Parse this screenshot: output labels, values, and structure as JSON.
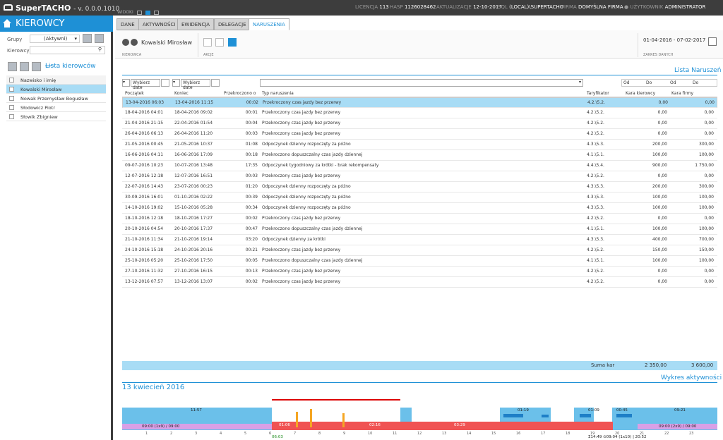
{
  "app": {
    "title": "SuperTACHO",
    "version": "- v. 0.0.0.1010",
    "widoki": "WIDOKI"
  },
  "topinfo": [
    {
      "k": "LICENCJA",
      "v": "113"
    },
    {
      "k": "HASP",
      "v": "1126028462"
    },
    {
      "k": "AKTUALIZACJE",
      "v": "12-10-2017"
    },
    {
      "k": "SQL",
      "v": "(LOCAL)\\SUPERTACHO"
    },
    {
      "k": "FIRMA",
      "v": "DOMYŚLNA FIRMA"
    },
    {
      "k": "UŻYTKOWNIK",
      "v": "ADMINISTRATOR"
    }
  ],
  "left": {
    "title": "KIEROWCY",
    "grupy_label": "Grupy",
    "grupy_value": "(Aktywni)",
    "kierowcy_label": "Kierowcy",
    "lista_title": "Lista kierowców",
    "col_header": "Nazwisko i imię",
    "drivers": [
      "Kowalski Mirosław",
      "Nowak Przemysław Bogusław",
      "Słodowicz Piotr",
      "Słowik Zbigniew"
    ]
  },
  "tabs": [
    "DANE",
    "AKTYWNOŚCI",
    "EWIDENCJA",
    "DELEGACJE",
    "NARUSZENIA"
  ],
  "ribbon": {
    "driver_name": "Kowalski Mirosław",
    "kierowca_label": "KIEROWCA",
    "akcje_label": "AKCJE",
    "date_range": "01-04-2016 - 07-02-2017",
    "zakres_label": "ZAKRES DANYCH"
  },
  "violations": {
    "title": "Lista Naruszeń",
    "filter_date1": "Wybierz datę",
    "filter_date2": "Wybierz datę",
    "od1": "Od",
    "do1": "Do",
    "od2": "Od",
    "do2": "Do",
    "columns": [
      "Początek",
      "Koniec",
      "Przekroczono o",
      "Typ naruszenia",
      "Taryfikator",
      "Kara kierowcy",
      "Kara firmy"
    ],
    "rows": [
      [
        "13-04-2016 06:03",
        "13-04-2016 11:15",
        "00:02",
        "Przekroczony czas jazdy bez przerwy",
        "4.2.\\5.2.",
        "0,00",
        "0,00"
      ],
      [
        "18-04-2016 04:01",
        "18-04-2016 09:02",
        "00:01",
        "Przekroczony czas jazdy bez przerwy",
        "4.2.\\5.2.",
        "0,00",
        "0,00"
      ],
      [
        "21-04-2016 21:15",
        "22-04-2016 01:54",
        "00:04",
        "Przekroczony czas jazdy bez przerwy",
        "4.2.\\5.2.",
        "0,00",
        "0,00"
      ],
      [
        "26-04-2016 06:13",
        "26-04-2016 11:20",
        "00:03",
        "Przekroczony czas jazdy bez przerwy",
        "4.2.\\5.2.",
        "0,00",
        "0,00"
      ],
      [
        "21-05-2016 00:45",
        "21-05-2016 10:37",
        "01:08",
        "Odpoczynek dzienny rozpoczęty za późno",
        "4.3.\\5.3.",
        "200,00",
        "300,00"
      ],
      [
        "16-06-2016 04:11",
        "16-06-2016 17:09",
        "00:18",
        "Przekroczono dopuszczalny czas jazdy dziennej",
        "4.1.\\5.1.",
        "100,00",
        "100,00"
      ],
      [
        "09-07-2016 10:23",
        "10-07-2016 13:48",
        "17:35",
        "Odpoczynek tygodniowy za krótki - brak rekompensaty",
        "4.4.\\5.4.",
        "900,00",
        "1 750,00"
      ],
      [
        "12-07-2016 12:18",
        "12-07-2016 16:51",
        "00:03",
        "Przekroczony czas jazdy bez przerwy",
        "4.2.\\5.2.",
        "0,00",
        "0,00"
      ],
      [
        "22-07-2016 14:43",
        "23-07-2016 00:23",
        "01:20",
        "Odpoczynek dzienny rozpoczęty za późno",
        "4.3.\\5.3.",
        "200,00",
        "300,00"
      ],
      [
        "30-09-2016 16:01",
        "01-10-2016 02:22",
        "00:39",
        "Odpoczynek dzienny rozpoczęty za późno",
        "4.3.\\5.3.",
        "100,00",
        "100,00"
      ],
      [
        "14-10-2016 19:02",
        "15-10-2016 05:28",
        "00:34",
        "Odpoczynek dzienny rozpoczęty za późno",
        "4.3.\\5.3.",
        "100,00",
        "100,00"
      ],
      [
        "18-10-2016 12:18",
        "18-10-2016 17:27",
        "00:02",
        "Przekroczony czas jazdy bez przerwy",
        "4.2.\\5.2.",
        "0,00",
        "0,00"
      ],
      [
        "20-10-2016 04:54",
        "20-10-2016 17:37",
        "00:47",
        "Przekroczono dopuszczalny czas jazdy dziennej",
        "4.1.\\5.1.",
        "100,00",
        "100,00"
      ],
      [
        "21-10-2016 11:34",
        "21-10-2016 19:14",
        "03:20",
        "Odpoczynek dzienny za krótki",
        "4.3.\\5.3.",
        "400,00",
        "700,00"
      ],
      [
        "24-10-2016 15:18",
        "24-10-2016 20:16",
        "00:21",
        "Przekroczony czas jazdy bez przerwy",
        "4.2.\\5.2.",
        "150,00",
        "150,00"
      ],
      [
        "25-10-2016 05:20",
        "25-10-2016 17:50",
        "00:05",
        "Przekroczono dopuszczalny czas jazdy dziennej",
        "4.1.\\5.1.",
        "100,00",
        "100,00"
      ],
      [
        "27-10-2016 11:32",
        "27-10-2016 16:15",
        "00:13",
        "Przekroczony czas jazdy bez przerwy",
        "4.2.\\5.2.",
        "0,00",
        "0,00"
      ],
      [
        "13-12-2016 07:57",
        "13-12-2016 13:07",
        "00:02",
        "Przekroczony czas jazdy bez przerwy",
        "4.2.\\5.2.",
        "0,00",
        "0,00"
      ]
    ],
    "sum_label": "Suma kar",
    "sum_driver": "2 350,00",
    "sum_company": "3 600,00"
  },
  "chart": {
    "date_title": "13 kwiecień 2016",
    "title": "Wykres aktywności",
    "labels_top": [
      "11:57",
      "01:19",
      "01:09",
      "00:45",
      "09:21"
    ],
    "labels_rest": [
      "09:00 (1x9) / 09:00",
      "09:00 (2x9) / 09:00"
    ],
    "labels_drive": [
      "01:06",
      "02:16",
      "03:29"
    ],
    "ticks": [
      "1",
      "2",
      "3",
      "4",
      "5",
      "6",
      "7",
      "8",
      "9",
      "10",
      "11",
      "12",
      "13",
      "14",
      "15",
      "16",
      "17",
      "18",
      "19",
      "20",
      "21",
      "22",
      "23"
    ],
    "start_marker": "06:03",
    "footer": "Σ14:49 ⊙09:04 (1x10) | 20:52"
  }
}
